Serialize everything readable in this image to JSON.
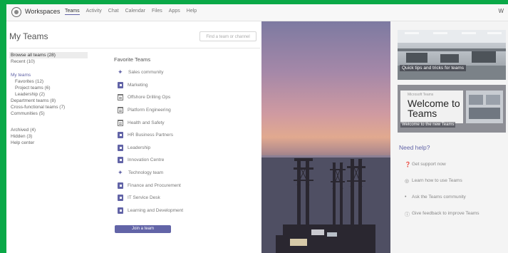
{
  "app": {
    "brand": "Workspaces",
    "nav": [
      "Teams",
      "Activity",
      "Chat",
      "Calendar",
      "Files",
      "Apps",
      "Help"
    ],
    "active_nav_index": 0,
    "right_label": "W"
  },
  "page": {
    "title": "My Teams",
    "search_placeholder": "Find a team or channel"
  },
  "sidebar": {
    "items": [
      {
        "label": "Browse all teams (28)",
        "kind": "selected"
      },
      {
        "label": "Recent (10)",
        "kind": "plain"
      },
      {
        "label": "My teams",
        "kind": "header"
      },
      {
        "label": "Favorites (12)",
        "kind": "indent"
      },
      {
        "label": "Project teams (6)",
        "kind": "indent"
      },
      {
        "label": "Leadership (2)",
        "kind": "indent"
      },
      {
        "label": "Department teams (8)",
        "kind": "plain"
      },
      {
        "label": "Cross-functional teams (7)",
        "kind": "plain"
      },
      {
        "label": "Communities (5)",
        "kind": "plain"
      },
      {
        "label": "Archived (4)",
        "kind": "gap"
      },
      {
        "label": "Hidden (3)",
        "kind": "plain"
      },
      {
        "label": "Help center",
        "kind": "plain"
      }
    ]
  },
  "teams": {
    "header": "Favorite Teams",
    "list": [
      {
        "name": "Sales community",
        "icon": "star-icon"
      },
      {
        "name": "Marketing",
        "icon": "book-icon"
      },
      {
        "name": "Offshore Drilling Ops",
        "icon": "document-icon"
      },
      {
        "name": "Platform Engineering",
        "icon": "document-icon"
      },
      {
        "name": "Health and Safety",
        "icon": "document-icon"
      },
      {
        "name": "HR Business Partners",
        "icon": "book-icon"
      },
      {
        "name": "Leadership",
        "icon": "book-icon"
      },
      {
        "name": "Innovation Centre",
        "icon": "book-icon"
      },
      {
        "name": "Technology team",
        "icon": "star-icon"
      },
      {
        "name": "Finance and Procurement",
        "icon": "book-icon"
      },
      {
        "name": "IT Service Desk",
        "icon": "book-icon"
      },
      {
        "name": "Learning and Development",
        "icon": "book-icon"
      }
    ],
    "join_button": "Join a team"
  },
  "right": {
    "card1_caption": "Quick tips and tricks for teams",
    "card2_subtitle": "Microsoft Teams",
    "card2_title": "Welcome to Teams",
    "card2_caption": "Welcome to the new Teams",
    "need_help": "Need help?",
    "help_links": [
      {
        "icon": "help-circle-icon",
        "label": "Get support now"
      },
      {
        "icon": "training-icon",
        "label": "Learn how to use Teams"
      },
      {
        "icon": "community-icon",
        "label": "Ask the Teams community"
      },
      {
        "icon": "lightbulb-icon",
        "label": "Give feedback to improve Teams"
      }
    ]
  }
}
